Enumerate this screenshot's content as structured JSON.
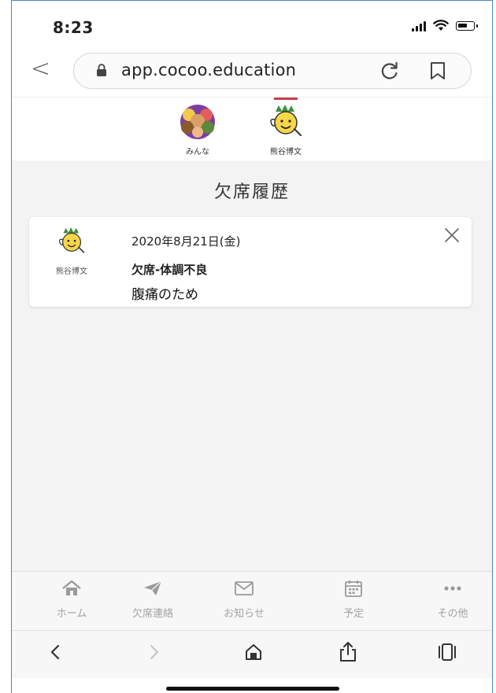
{
  "status_bar": {
    "time": "8:23"
  },
  "browser": {
    "url": "app.cocoo.education"
  },
  "profiles": [
    {
      "label": "みんな"
    },
    {
      "label": "熊谷博文"
    }
  ],
  "page": {
    "title": "欠席履歴",
    "record": {
      "student_name": "熊谷博文",
      "date": "2020年8月21日(金)",
      "reason": "欠席-体調不良",
      "note": "腹痛のため"
    }
  },
  "tabs": [
    {
      "label": "ホーム",
      "icon": "home-icon"
    },
    {
      "label": "欠席連絡",
      "icon": "paper-plane-icon"
    },
    {
      "label": "お知らせ",
      "icon": "mail-icon"
    },
    {
      "label": "予定",
      "icon": "calendar-icon"
    },
    {
      "label": "その他",
      "icon": "more-icon"
    }
  ],
  "colors": {
    "accent": "#c8404a",
    "tab_inactive": "#9a9a9a"
  }
}
